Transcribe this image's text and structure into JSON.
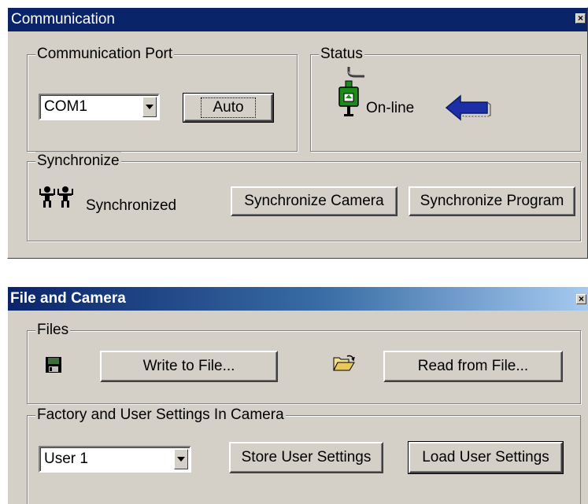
{
  "communication": {
    "title": "Communication",
    "close_icon": "close-icon",
    "port_group": {
      "label": "Communication Port",
      "selected": "COM1",
      "auto_label": "Auto"
    },
    "status_group": {
      "label": "Status",
      "status_text": "On-line",
      "icons": [
        "plug-icon",
        "arrow-left-icon"
      ]
    },
    "sync_group": {
      "label": "Synchronize",
      "status_text": "Synchronized",
      "icon": "people-icon",
      "camera_button": "Synchronize Camera",
      "program_button": "Synchronize Program"
    }
  },
  "file_camera": {
    "title": "File and Camera",
    "close_icon": "close-icon",
    "files_group": {
      "label": "Files",
      "write_button": "Write to File...",
      "read_button": "Read from File...",
      "icons": [
        "floppy-disk-icon",
        "open-folder-icon"
      ]
    },
    "settings_group": {
      "label": "Factory and User Settings In Camera",
      "selected": "User 1",
      "store_button": "Store User Settings",
      "load_button": "Load User Settings"
    }
  },
  "colors": {
    "window_bg": "#d4d0c8",
    "comm_title_bg": "#0a246a",
    "file_title_gradient": [
      "#0a246a",
      "#a6caf0"
    ],
    "arrow_blue": "#1c2fa6",
    "plug_green": "#1a8c1a"
  }
}
